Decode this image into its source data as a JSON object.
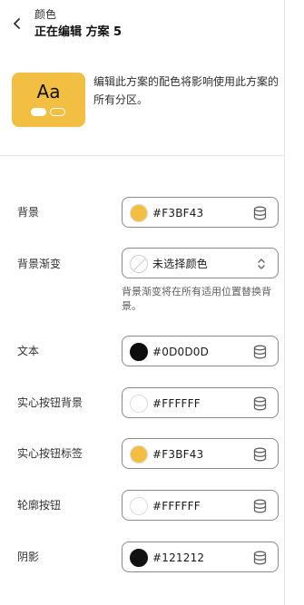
{
  "header": {
    "back_icon": "chevron-left-icon",
    "subtitle": "颜色",
    "title": "正在编辑 方案 5"
  },
  "preview": {
    "sample_text": "Aa",
    "bg_color": "#F3BF43",
    "description": "编辑此方案的配色将影响使用此方案的所有分区。"
  },
  "fields": [
    {
      "label": "背景",
      "value": "#F3BF43",
      "swatch": "#F3BF43",
      "icon": "database-icon"
    },
    {
      "label": "背景渐变",
      "value": "未选择颜色",
      "swatch": "none",
      "icon": "chevron-up-down-icon",
      "help": "背景渐变将在所有适用位置替换背景。"
    },
    {
      "label": "文本",
      "value": "#0D0D0D",
      "swatch": "#0D0D0D",
      "icon": "database-icon"
    },
    {
      "label": "实心按钮背景",
      "value": "#FFFFFF",
      "swatch": "#FFFFFF",
      "icon": "database-icon"
    },
    {
      "label": "实心按钮标签",
      "value": "#F3BF43",
      "swatch": "#F3BF43",
      "icon": "database-icon"
    },
    {
      "label": "轮廓按钮",
      "value": "#FFFFFF",
      "swatch": "#FFFFFF",
      "icon": "database-icon"
    },
    {
      "label": "阴影",
      "value": "#121212",
      "swatch": "#121212",
      "icon": "database-icon"
    }
  ]
}
